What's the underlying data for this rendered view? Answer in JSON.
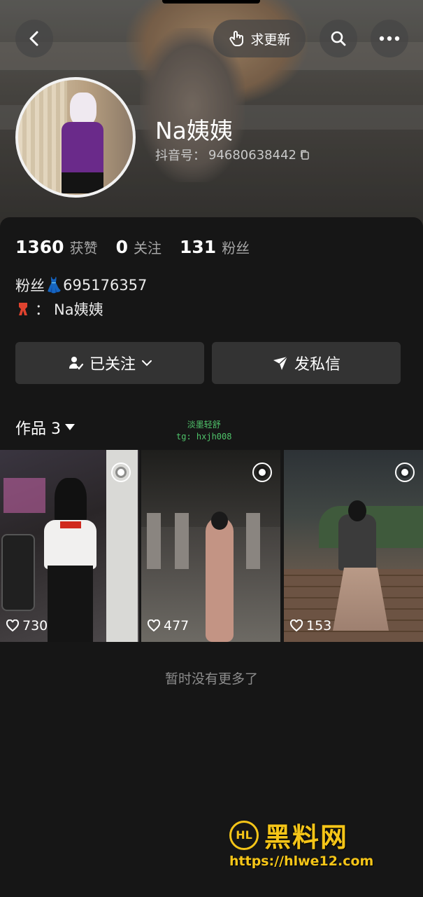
{
  "header": {
    "update_label": "求更新"
  },
  "profile": {
    "name": "Na姨姨",
    "douyin_id_label": "抖音号：",
    "douyin_id": "94680638442"
  },
  "stats": [
    {
      "num": "1360",
      "label": "获赞"
    },
    {
      "num": "0",
      "label": "关注"
    },
    {
      "num": "131",
      "label": "粉丝"
    }
  ],
  "bio": {
    "line1_text": "粉丝",
    "line1_emoji": "👗",
    "line1_number": "695176357",
    "line2_prefix": "：",
    "line2_text": "Na姨姨"
  },
  "actions": {
    "follow_label": "已关注",
    "message_label": "发私信"
  },
  "works": {
    "title": "作品 3",
    "watermark_line1": "淡墨轻舒",
    "watermark_line2": "tg: hxjh008",
    "items": [
      {
        "likes": "730"
      },
      {
        "likes": "477"
      },
      {
        "likes": "153"
      }
    ],
    "no_more": "暂时没有更多了"
  },
  "branding": {
    "logo_mark": "HL",
    "name": "黑料网",
    "url": "https://hlwe12.com"
  },
  "colors": {
    "accent": "#f5c518",
    "background": "#161616",
    "button": "#333333"
  }
}
